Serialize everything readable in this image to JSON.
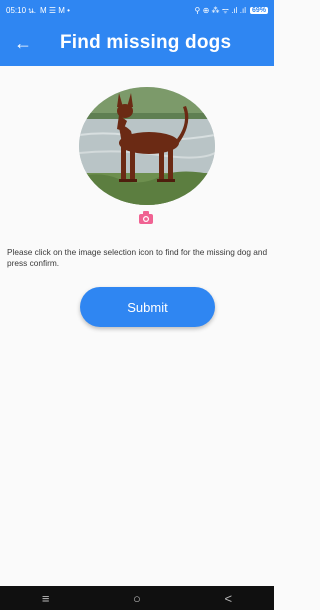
{
  "status_bar": {
    "time": "05:10 น.",
    "left_icons": "M ☰ M •",
    "right_icons": "⚲ ⊕ ⁂ ᯤ .ıl .ıl",
    "battery": "69%"
  },
  "app_bar": {
    "back_icon": "←",
    "title": "Find missing dogs"
  },
  "main": {
    "image_alt": "dog photo",
    "camera_icon": "camera-icon",
    "instruction": "Please click on the image selection icon to  find for the missing dog and press confirm.",
    "submit_label": "Submit"
  },
  "nav_bar": {
    "recent_icon": "≡",
    "home_icon": "○",
    "back_icon": "<"
  },
  "colors": {
    "primary": "#2f86f2",
    "camera": "#f06292"
  }
}
